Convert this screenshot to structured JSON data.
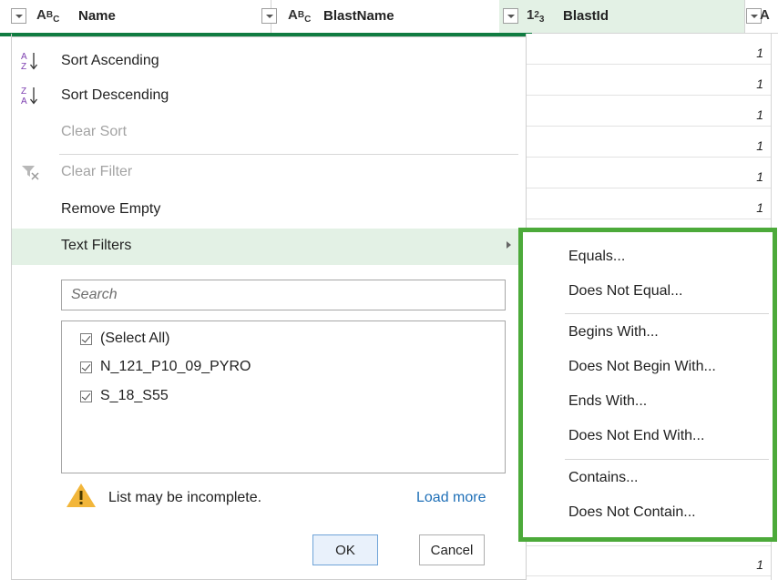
{
  "columns": [
    {
      "type_main": "A",
      "type_sup": "B",
      "type_sub": "C",
      "title": "Name"
    },
    {
      "type_main": "A",
      "type_sup": "B",
      "type_sub": "C",
      "title": "BlastName"
    },
    {
      "type_main": "1",
      "type_sup": "2",
      "type_sub": "3",
      "title": "BlastId"
    },
    {
      "type_main": "A",
      "type_sup": "",
      "type_sub": "",
      "title": ""
    }
  ],
  "grid_values": [
    "1",
    "1",
    "1",
    "1",
    "1",
    "1",
    "1"
  ],
  "menu": {
    "sort_ascending": "Sort Ascending",
    "sort_descending": "Sort Descending",
    "clear_sort": "Clear Sort",
    "clear_filter": "Clear Filter",
    "remove_empty": "Remove Empty",
    "text_filters": "Text Filters",
    "search_placeholder": "Search",
    "list_items": [
      "(Select All)",
      "N_121_P10_09_PYRO",
      "S_18_S55"
    ],
    "warning_text": "List may be incomplete.",
    "load_more": "Load more",
    "ok_label": "OK",
    "cancel_label": "Cancel"
  },
  "submenu": {
    "items": [
      "Equals...",
      "Does Not Equal...",
      "Begins With...",
      "Does Not Begin With...",
      "Ends With...",
      "Does Not End With...",
      "Contains...",
      "Does Not Contain..."
    ]
  },
  "colors": {
    "accent_green": "#107c41",
    "highlight_green": "#e3f1e5",
    "submenu_border": "#4caa3a",
    "link_blue": "#1e6fb7"
  }
}
